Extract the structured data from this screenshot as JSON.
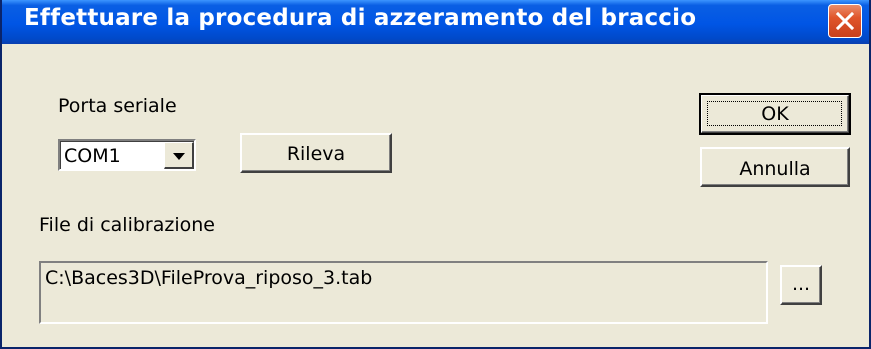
{
  "window": {
    "title": "Effettuare la procedura di azzeramento del braccio"
  },
  "serial_port": {
    "label": "Porta seriale",
    "selected": "COM1"
  },
  "buttons": {
    "detect": "Rileva",
    "ok": "OK",
    "cancel": "Annulla",
    "browse": "..."
  },
  "calibration": {
    "label": "File di calibrazione",
    "path": "C:\\Baces3D\\FileProva_riposo_3.tab"
  },
  "icons": {
    "close": "close-icon",
    "dropdown": "chevron-down-icon"
  },
  "colors": {
    "titlebar": "#0055e5",
    "close_button": "#e0552a",
    "dialog_background": "#ece9d8"
  }
}
